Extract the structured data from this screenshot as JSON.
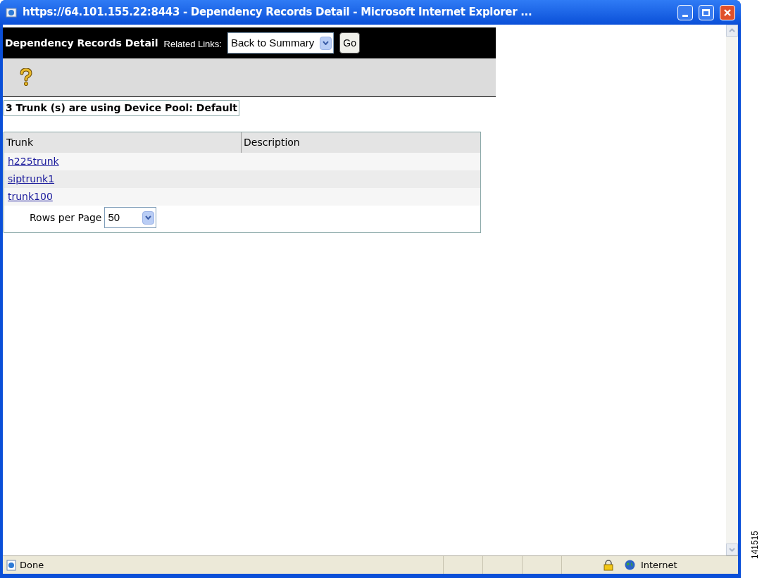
{
  "window": {
    "title": "https://64.101.155.22:8443 - Dependency Records Detail - Microsoft Internet Explorer ..."
  },
  "header": {
    "title": "Dependency Records Detail",
    "related_label": "Related Links:",
    "related_value": "Back to Summary",
    "go": "Go"
  },
  "summary": "3 Trunk (s) are using Device Pool: Default",
  "table": {
    "columns": [
      "Trunk",
      "Description"
    ],
    "rows": [
      {
        "trunk": "h225trunk"
      },
      {
        "trunk": "siptrunk1"
      },
      {
        "trunk": "trunk100"
      }
    ],
    "rows_per_page_label": "Rows per Page",
    "rows_per_page": "50"
  },
  "status_bar": {
    "text": "Done",
    "zone": "Internet"
  },
  "figure_number": "141515"
}
